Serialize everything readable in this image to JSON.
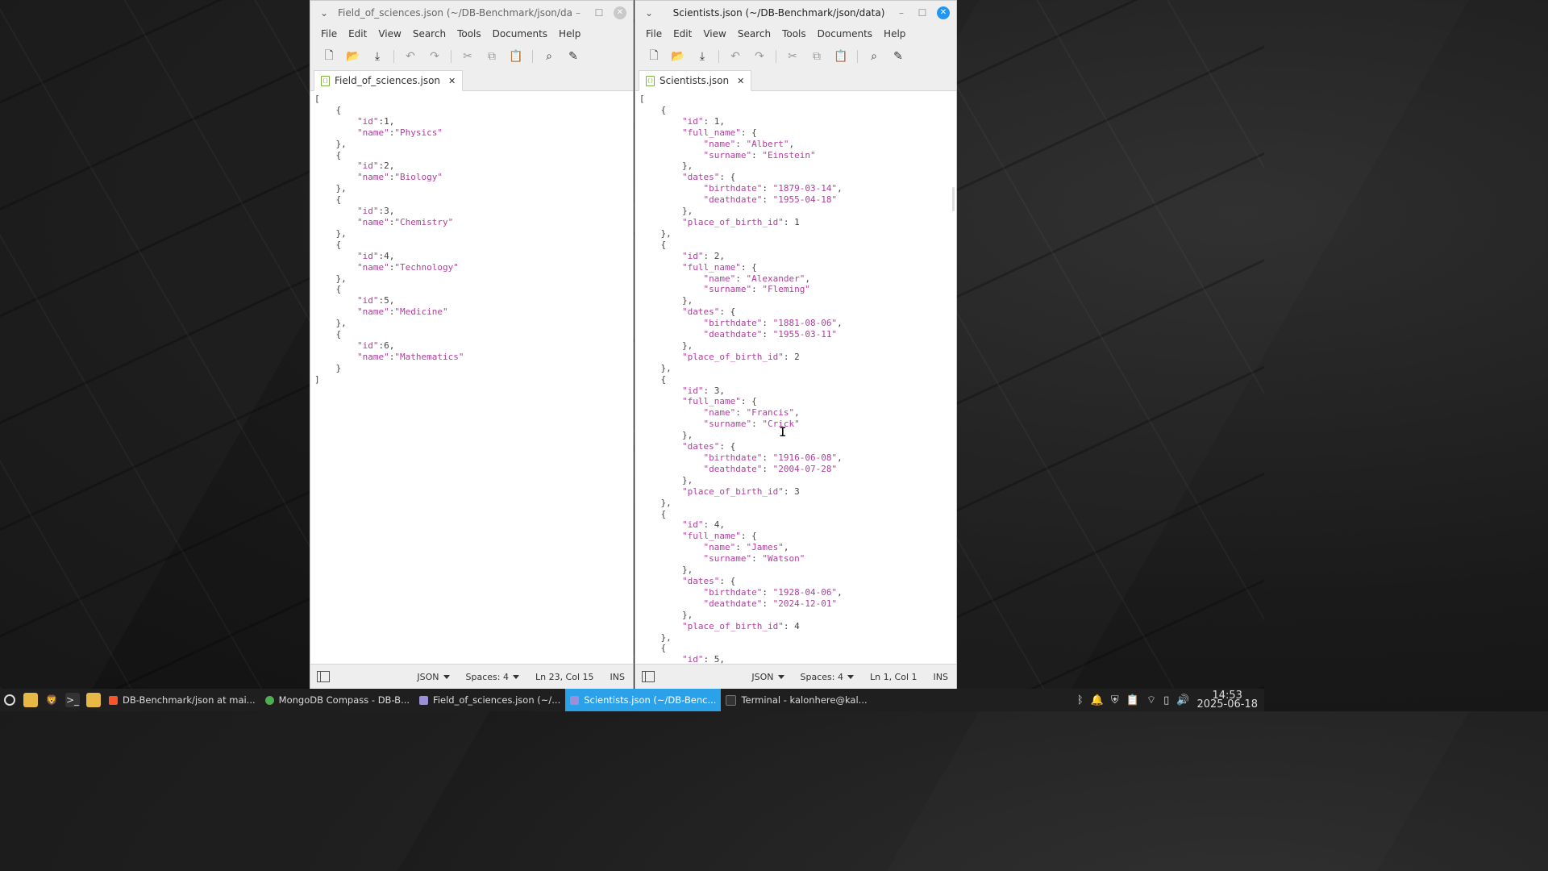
{
  "left_window": {
    "title": "Field_of_sciences.json (~/DB-Benchmark/json/data)",
    "menu": [
      "File",
      "Edit",
      "View",
      "Search",
      "Tools",
      "Documents",
      "Help"
    ],
    "tab_label": "Field_of_sciences.json",
    "content": "[\n    {\n        \"id\":1,\n        \"name\":\"Physics\"\n    },\n    {\n        \"id\":2,\n        \"name\":\"Biology\"\n    },\n    {\n        \"id\":3,\n        \"name\":\"Chemistry\"\n    },\n    {\n        \"id\":4,\n        \"name\":\"Technology\"\n    },\n    {\n        \"id\":5,\n        \"name\":\"Medicine\"\n    },\n    {\n        \"id\":6,\n        \"name\":\"Mathematics\"\n    }\n]",
    "status": {
      "language": "JSON",
      "spaces": "Spaces: 4",
      "position": "Ln 23, Col 15",
      "mode": "INS"
    }
  },
  "right_window": {
    "title": "Scientists.json (~/DB-Benchmark/json/data)",
    "menu": [
      "File",
      "Edit",
      "View",
      "Search",
      "Tools",
      "Documents",
      "Help"
    ],
    "tab_label": "Scientists.json",
    "content": "[\n    {\n        \"id\": 1,\n        \"full_name\": {\n            \"name\": \"Albert\",\n            \"surname\": \"Einstein\"\n        },\n        \"dates\": {\n            \"birthdate\": \"1879-03-14\",\n            \"deathdate\": \"1955-04-18\"\n        },\n        \"place_of_birth_id\": 1\n    },\n    {\n        \"id\": 2,\n        \"full_name\": {\n            \"name\": \"Alexander\",\n            \"surname\": \"Fleming\"\n        },\n        \"dates\": {\n            \"birthdate\": \"1881-08-06\",\n            \"deathdate\": \"1955-03-11\"\n        },\n        \"place_of_birth_id\": 2\n    },\n    {\n        \"id\": 3,\n        \"full_name\": {\n            \"name\": \"Francis\",\n            \"surname\": \"Crick\"\n        },\n        \"dates\": {\n            \"birthdate\": \"1916-06-08\",\n            \"deathdate\": \"2004-07-28\"\n        },\n        \"place_of_birth_id\": 3\n    },\n    {\n        \"id\": 4,\n        \"full_name\": {\n            \"name\": \"James\",\n            \"surname\": \"Watson\"\n        },\n        \"dates\": {\n            \"birthdate\": \"1928-04-06\",\n            \"deathdate\": \"2024-12-01\"\n        },\n        \"place_of_birth_id\": 4\n    },\n    {\n        \"id\": 5,",
    "status": {
      "language": "JSON",
      "spaces": "Spaces: 4",
      "position": "Ln 1, Col 1",
      "mode": "INS"
    }
  },
  "taskbar": {
    "tasks": [
      {
        "label": "DB-Benchmark/json at mai...",
        "icon": "brave-browser-icon"
      },
      {
        "label": "MongoDB Compass - DB-B...",
        "icon": "mongodb-compass-icon"
      },
      {
        "label": "Field_of_sciences.json (~/...",
        "icon": "text-editor-icon"
      },
      {
        "label": "Scientists.json (~/DB-Benc...",
        "icon": "text-editor-icon"
      },
      {
        "label": "Terminal - kalonhere@kal...",
        "icon": "terminal-icon"
      }
    ],
    "clock_time": "14:53",
    "clock_date": "2025-06-18"
  },
  "colors": {
    "accent": "#2aa1e8",
    "string": "#b03e9e",
    "close_active": "#2196f3"
  }
}
